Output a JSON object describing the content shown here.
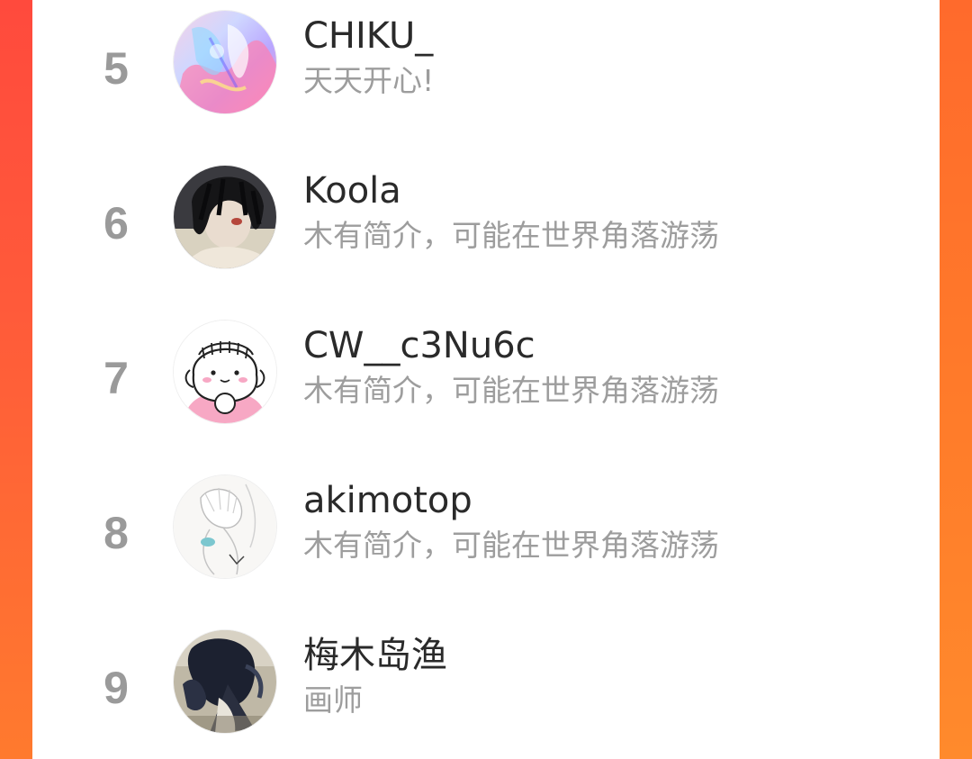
{
  "theme": {
    "accent": "#ff5a3a",
    "rank_color": "#9a9a9a",
    "name_color": "#2a2a2a",
    "bio_color": "#9d9d9d"
  },
  "ranking": {
    "items": [
      {
        "rank": "5",
        "name": "CHIKU_",
        "bio": "天天开心!",
        "avatar_icon": "avatar-pastel-illustration"
      },
      {
        "rank": "6",
        "name": "Koola",
        "bio": "木有简介，可能在世界角落游荡",
        "avatar_icon": "avatar-dark-hair-character"
      },
      {
        "rank": "7",
        "name": "CW__c3Nu6c",
        "bio": "木有简介，可能在世界角落游荡",
        "avatar_icon": "avatar-cute-doodle-girl"
      },
      {
        "rank": "8",
        "name": "akimotop",
        "bio": "木有简介，可能在世界角落游荡",
        "avatar_icon": "avatar-sketch-figure"
      },
      {
        "rank": "9",
        "name": "梅木岛渔",
        "bio": "画师",
        "avatar_icon": "avatar-dark-painting"
      }
    ]
  }
}
